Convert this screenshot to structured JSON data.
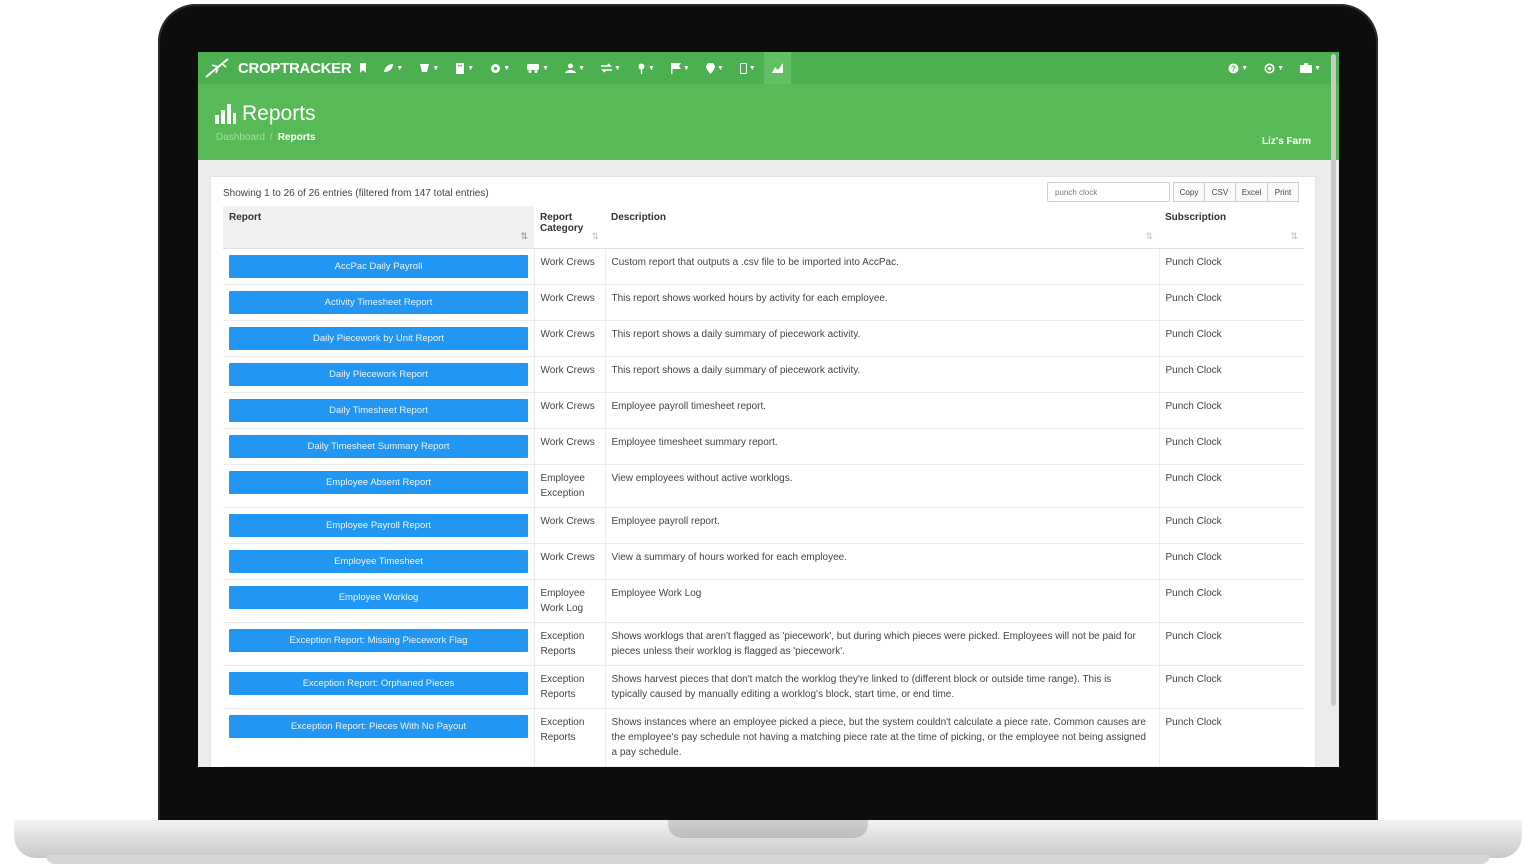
{
  "app": {
    "brand": "CROPTRACKER",
    "farm_name": "Liz's Farm",
    "accent_color": "#4caf50",
    "header_color": "#58b957",
    "button_color": "#2196f3"
  },
  "nav": {
    "icons": [
      "bookmark-icon",
      "leaf-icon",
      "plant-icon",
      "building-icon",
      "gear-icon",
      "truck-icon",
      "user-icon",
      "transfer-icon",
      "pin-icon",
      "flag-icon",
      "location-icon",
      "mobile-icon",
      "reports-icon"
    ],
    "right_icons": [
      "help-icon",
      "support-icon",
      "account-icon"
    ]
  },
  "page": {
    "title": "Reports",
    "breadcrumb": {
      "home": "Dashboard",
      "separator": "/",
      "current": "Reports"
    }
  },
  "table": {
    "entries_info": "Showing 1 to 26 of 26 entries (filtered from 147 total entries)",
    "search_value": "punch clock",
    "export_buttons": [
      "Copy",
      "CSV",
      "Excel",
      "Print"
    ],
    "headers": {
      "report": "Report",
      "category_line1": "Report",
      "category_line2": "Category",
      "description": "Description",
      "subscription": "Subscription"
    },
    "rows": [
      {
        "report": "AccPac Daily Payroll",
        "category": "Work Crews",
        "description": "Custom report that outputs a .csv file to be imported into AccPac.",
        "subscription": "Punch Clock"
      },
      {
        "report": "Activity Timesheet Report",
        "category": "Work Crews",
        "description": "This report shows worked hours by activity for each employee.",
        "subscription": "Punch Clock"
      },
      {
        "report": "Daily Piecework by Unit Report",
        "category": "Work Crews",
        "description": "This report shows a daily summary of piecework activity.",
        "subscription": "Punch Clock"
      },
      {
        "report": "Daily Piecework Report",
        "category": "Work Crews",
        "description": "This report shows a daily summary of piecework activity.",
        "subscription": "Punch Clock"
      },
      {
        "report": "Daily Timesheet Report",
        "category": "Work Crews",
        "description": "Employee payroll timesheet report.",
        "subscription": "Punch Clock"
      },
      {
        "report": "Daily Timesheet Summary Report",
        "category": "Work Crews",
        "description": "Employee timesheet summary report.",
        "subscription": "Punch Clock"
      },
      {
        "report": "Employee Absent Report",
        "category": "Employee Exception",
        "description": "View employees without active worklogs.",
        "subscription": "Punch Clock"
      },
      {
        "report": "Employee Payroll Report",
        "category": "Work Crews",
        "description": "Employee payroll report.",
        "subscription": "Punch Clock"
      },
      {
        "report": "Employee Timesheet",
        "category": "Work Crews",
        "description": "View a summary of hours worked for each employee.",
        "subscription": "Punch Clock"
      },
      {
        "report": "Employee Worklog",
        "category": "Employee Work Log",
        "description": "Employee Work Log",
        "subscription": "Punch Clock"
      },
      {
        "report": "Exception Report: Missing Piecework Flag",
        "category": "Exception Reports",
        "description": "Shows worklogs that aren't flagged as 'piecework', but during which pieces were picked. Employees will not be paid for pieces unless their worklog is flagged as 'piecework'.",
        "subscription": "Punch Clock"
      },
      {
        "report": "Exception Report: Orphaned Pieces",
        "category": "Exception Reports",
        "description": "Shows harvest pieces that don't match the worklog they're linked to (different block or outside time range). This is typically caused by manually editing a worklog's block, start time, or end time.",
        "subscription": "Punch Clock"
      },
      {
        "report": "Exception Report: Pieces With No Payout",
        "category": "Exception Reports",
        "description": "Shows instances where an employee picked a piece, but the system couldn't calculate a piece rate. Common causes are the employee's pay schedule not having a matching piece rate at the time of picking, or the employee not being assigned a pay schedule.",
        "subscription": "Punch Clock"
      }
    ]
  }
}
